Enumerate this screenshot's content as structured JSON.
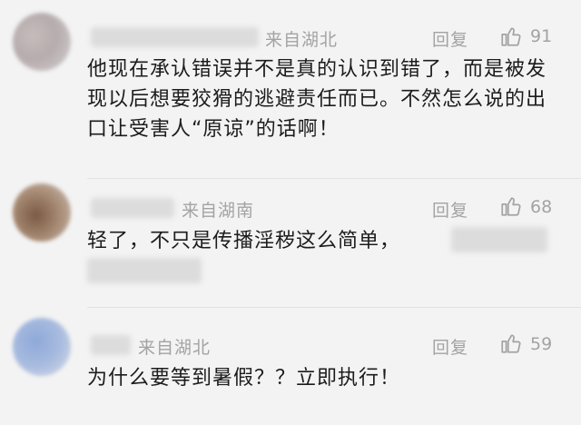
{
  "comments": [
    {
      "location": "来自湖北",
      "reply_label": "回复",
      "likes": "91",
      "text": "他现在承认错误并不是真的认识到错了，而是被发现以后想要狡猾的逃避责任而已。不然怎么说的出口让受害人“原谅”的话啊！"
    },
    {
      "location": "来自湖南",
      "reply_label": "回复",
      "likes": "68",
      "text": "轻了，不只是传播淫秽这么简单，"
    },
    {
      "location": "来自湖北",
      "reply_label": "回复",
      "likes": "59",
      "text": "为什么要等到暑假？？立即执行！"
    }
  ],
  "icons": {
    "like": "thumbs-up-icon"
  },
  "colors": {
    "background": "#f3f3f3",
    "meta_text": "#a3a3a3",
    "body_text": "#1c1c1c"
  }
}
